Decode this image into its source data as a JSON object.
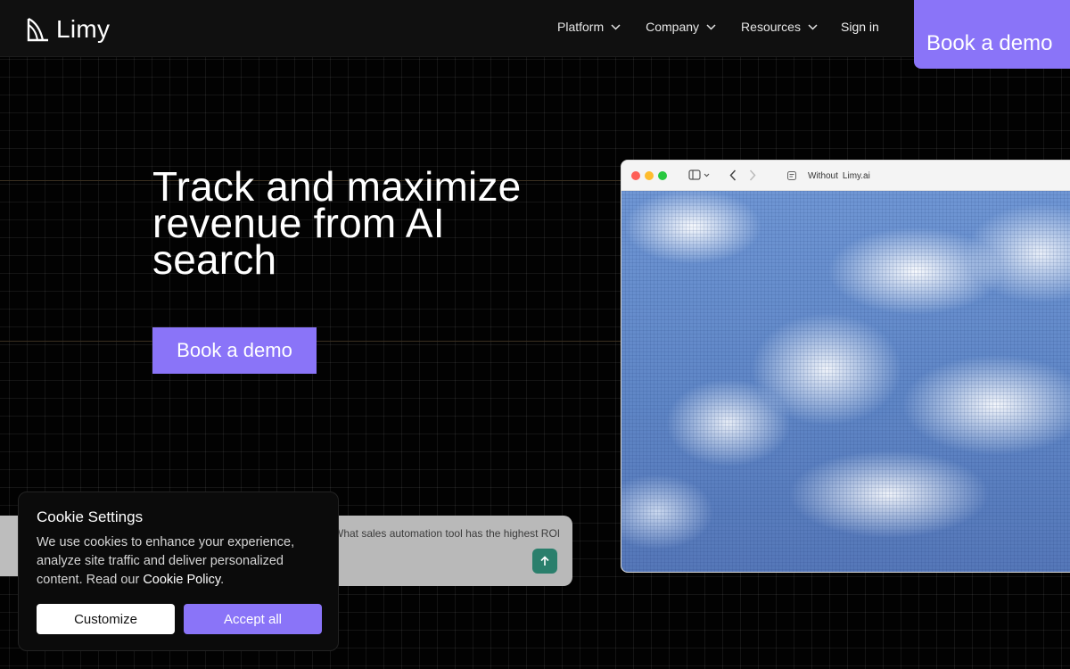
{
  "brand": {
    "name": "Limy",
    "logo_icon": "limy-logo-icon"
  },
  "nav": {
    "items": [
      {
        "label": "Platform",
        "icon": "chevron-down-icon"
      },
      {
        "label": "Company",
        "icon": "chevron-down-icon"
      },
      {
        "label": "Resources",
        "icon": "chevron-down-icon"
      }
    ],
    "signin_label": "Sign in",
    "cta_label": "Book a demo"
  },
  "hero": {
    "title_lines": [
      "Track and maximize",
      "revenue from AI",
      "search"
    ],
    "cta_label": "Book a demo"
  },
  "browser_mock": {
    "url_parts": [
      "Without",
      "Limy.ai"
    ],
    "icons": [
      "sidebar-toggle-icon",
      "chevron-down-icon",
      "back-arrow-icon",
      "forward-arrow-icon",
      "page-icon"
    ]
  },
  "chat_mock": {
    "prompt_text": "What sales automation tool has the highest ROI",
    "send_icon": "arrow-up-icon"
  },
  "cookie": {
    "title": "Cookie Settings",
    "body_prefix": "We use cookies to enhance your experience, analyze site traffic and deliver personalized content. Read our ",
    "link_label": "Cookie Policy",
    "body_suffix": ".",
    "customize_label": "Customize",
    "accept_label": "Accept all"
  },
  "colors": {
    "accent": "#8a74f8",
    "background": "#020202",
    "header_bg": "#101010",
    "send_button": "#2a7f6c"
  }
}
